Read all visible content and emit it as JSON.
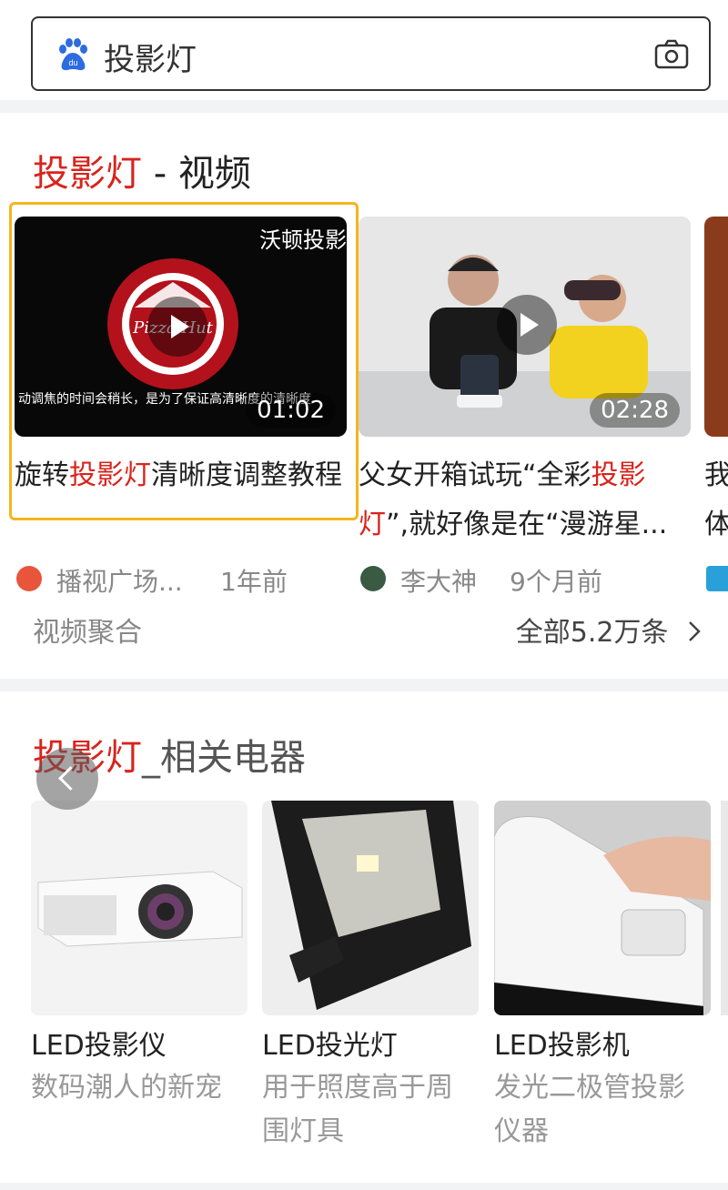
{
  "search": {
    "query": "投影灯"
  },
  "video_section": {
    "title_keyword": "投影灯",
    "title_rest": " - 视频",
    "videos": [
      {
        "title_pre": "旋转",
        "title_kw": "投影灯",
        "title_post": "清晰度调整教程",
        "duration": "01:02",
        "source": "播视广场...",
        "time": "1年前",
        "overlay_top": "沃顿投影",
        "overlay_caption": "动调焦的时间会稍长，是为了保证高清晰度的清晰度"
      },
      {
        "title_pre": "父女开箱试玩“全彩",
        "title_kw": "投影灯",
        "title_post": "”,就好像是在“漫游星...",
        "duration": "02:28",
        "source": "李大神",
        "time": "9个月前"
      },
      {
        "title_pre": "我",
        "title_kw": "",
        "title_post": "体"
      }
    ],
    "footer_left": "视频聚合",
    "footer_right": "全部5.2万条"
  },
  "appliance_section": {
    "title_keyword": "投影灯",
    "title_rest": "_相关电器",
    "products": [
      {
        "name": "LED投影仪",
        "desc": "数码潮人的新宠"
      },
      {
        "name": "LED投光灯",
        "desc": "用于照度高于周围灯具"
      },
      {
        "name": "LED投影机",
        "desc": "发光二极管投影仪器"
      }
    ]
  },
  "colors": {
    "accent_red": "#d8241d",
    "highlight_border": "#f5b51d",
    "baidu_blue": "#2d6ce0"
  },
  "icons": [
    "baidu-paw-icon",
    "camera-icon",
    "play-icon",
    "chevron-right-icon",
    "back-arrow-icon"
  ]
}
